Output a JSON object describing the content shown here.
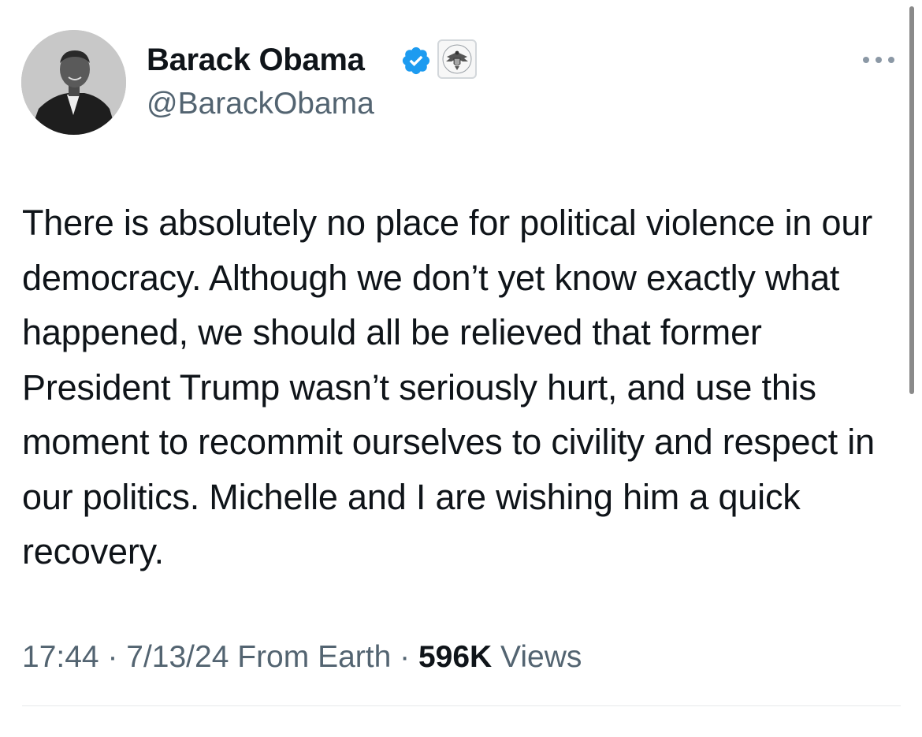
{
  "user": {
    "display_name": "Barack Obama",
    "handle": "@BarackObama"
  },
  "tweet": {
    "text": "There is absolutely no place for political violence in our democracy. Although we don’t yet know exactly what happened, we should all be relieved that former President Trump wasn’t seriously hurt, and use this moment to recommit ourselves to civility and respect in our politics. Michelle and I are wishing him a quick recovery.",
    "time": "17:44",
    "date": "7/13/24",
    "source": "From Earth",
    "views_count": "596K",
    "views_label": "Views",
    "separator": " · "
  },
  "icons": {
    "avatar": "profile-photo",
    "verified": "verified-badge-icon",
    "affiliation": "government-seal-icon",
    "more": "more-options-icon"
  },
  "colors": {
    "verified_blue": "#1d9bf0",
    "secondary_text": "#536471",
    "primary_text": "#0f1419"
  }
}
